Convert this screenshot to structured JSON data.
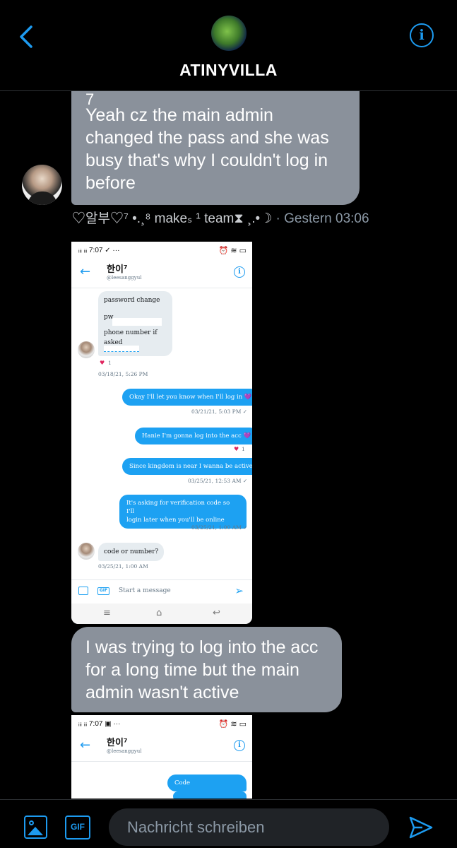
{
  "header": {
    "title": "ATINYVILLA",
    "back_icon": "chevron-left-icon",
    "info_icon": "info-icon"
  },
  "messages": [
    {
      "lines": [
        "Yeah cz the main admin",
        "changed the pass and she was",
        "busy that's why I couldn't log in",
        "before"
      ],
      "stub": "7"
    }
  ],
  "meta": {
    "sender": "♡알부♡⁷ •.¸⁸ makeₛ ¹ team⧗ ¸.•☽",
    "time": "· Gestern 03:06"
  },
  "message2": {
    "lines": [
      "I was trying to log into the acc",
      "for a long time but the main",
      "admin wasn't active"
    ]
  },
  "screenshot": {
    "status_time": "7:07",
    "name": "한이⁷",
    "handle": "@leesanggyul",
    "received_lines": [
      "password change",
      "pw",
      "phone number if asked"
    ],
    "received_heart_count": "1",
    "received_time": "03/18/21, 5:26 PM",
    "sent": [
      {
        "text": "Okay I'll let you know when I'll log in 💜",
        "time": "03/21/21, 5:03 PM ✓"
      },
      {
        "text": "Hanie I'm gonna log into the acc 💜",
        "heart": "1"
      },
      {
        "text": "Since kingdom is near I wanna be active",
        "time": "03/25/21, 12:53 AM ✓"
      },
      {
        "lines": [
          "It's asking for verification code so I'll",
          "login later when you'll be online"
        ],
        "time": "03/25/21, 1:00 AM ✓"
      }
    ],
    "reply": {
      "text": "code or number?",
      "time": "03/25/21, 1:00 AM"
    },
    "compose_placeholder": "Start a message",
    "gif_label": "GIF"
  },
  "screenshot2": {
    "status_time": "7:07",
    "name": "한이⁷",
    "handle": "@leesanggyul",
    "sent_text": "Code"
  },
  "composer": {
    "placeholder": "Nachricht schreiben",
    "gif_label": "GIF",
    "image_icon": "image-icon",
    "send_icon": "send-icon"
  },
  "colors": {
    "accent": "#1d9bf0",
    "bubble": "#8a919b",
    "background": "#000000"
  }
}
